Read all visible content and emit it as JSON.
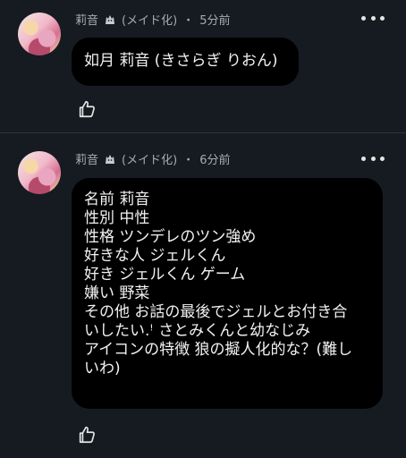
{
  "posts": [
    {
      "author": "莉音",
      "tag": "(メイド化)",
      "separator": "・",
      "time": "5分前",
      "lines": [
        "如月 莉音 (きさらぎ りおん)"
      ]
    },
    {
      "author": "莉音",
      "tag": "(メイド化)",
      "separator": "・",
      "time": "6分前",
      "lines": [
        "名前 莉音",
        "性別 中性",
        "性格 ツンデレのツン強め",
        "好きな人 ジェルくん",
        "好き ジェルくん ゲーム",
        "嫌い 野菜",
        "その他 お話の最後でジェルとお付き合",
        "いしたい.ꜝ さとみくんと幼なじみ",
        "アイコンの特徴 狼の擬人化的な？(難し",
        "いわ)"
      ]
    }
  ],
  "icons": {
    "author_badge": "wolf-icon",
    "more": "more-options-icon",
    "like": "thumbs-up-icon"
  },
  "colors": {
    "background": "#161b22",
    "bubble": "#000000",
    "meta_text": "#a7abb3"
  }
}
